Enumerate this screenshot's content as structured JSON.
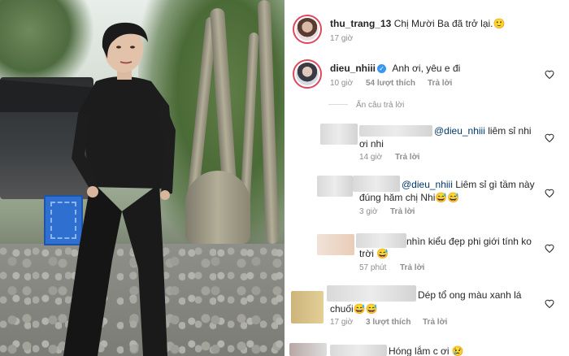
{
  "comments": [
    {
      "username": "thu_trang_13",
      "text": "Chị Mười Ba đã trở lại.",
      "emoji": "🙂",
      "time": "17 giờ"
    },
    {
      "username": "dieu_nhiii",
      "verified": true,
      "text": "Anh ơi, yêu e đi",
      "time": "10 giờ",
      "likes": "54 lượt thích",
      "reply_label": "Trả lời",
      "hide_replies": "Ẩn câu trả lời"
    }
  ],
  "replies": [
    {
      "mention": "@dieu_nhiii",
      "text_line1": " liêm sỉ nhi",
      "text_line2": "ơi nhi",
      "time": "14 giờ",
      "reply_label": "Trả lời"
    },
    {
      "mention": "@dieu_nhiii",
      "text_line1": " Liêm sỉ gì tầm này",
      "text_line2": "đúng hăm chị Nhi😅😅",
      "time": "3 giờ",
      "reply_label": "Trả lời"
    },
    {
      "text_line1": "nhìn kiểu đẹp phi giới tính ko",
      "text_line2": "trời 😅",
      "time": "57 phút",
      "reply_label": "Trả lời"
    }
  ],
  "more_comments": [
    {
      "text_line1": "Dép tổ ong màu xanh lá",
      "text_line2": "chuối😅😅",
      "time": "17 giờ",
      "likes": "3 lượt thích",
      "reply_label": "Trả lời"
    },
    {
      "text_line1": "Hóng lắm c ơi 😢"
    }
  ],
  "colors": {
    "username": "#262626",
    "meta": "#8e8e8e",
    "mention": "#00376b",
    "verified": "#3897f0",
    "story_ring": "#e0485c"
  }
}
